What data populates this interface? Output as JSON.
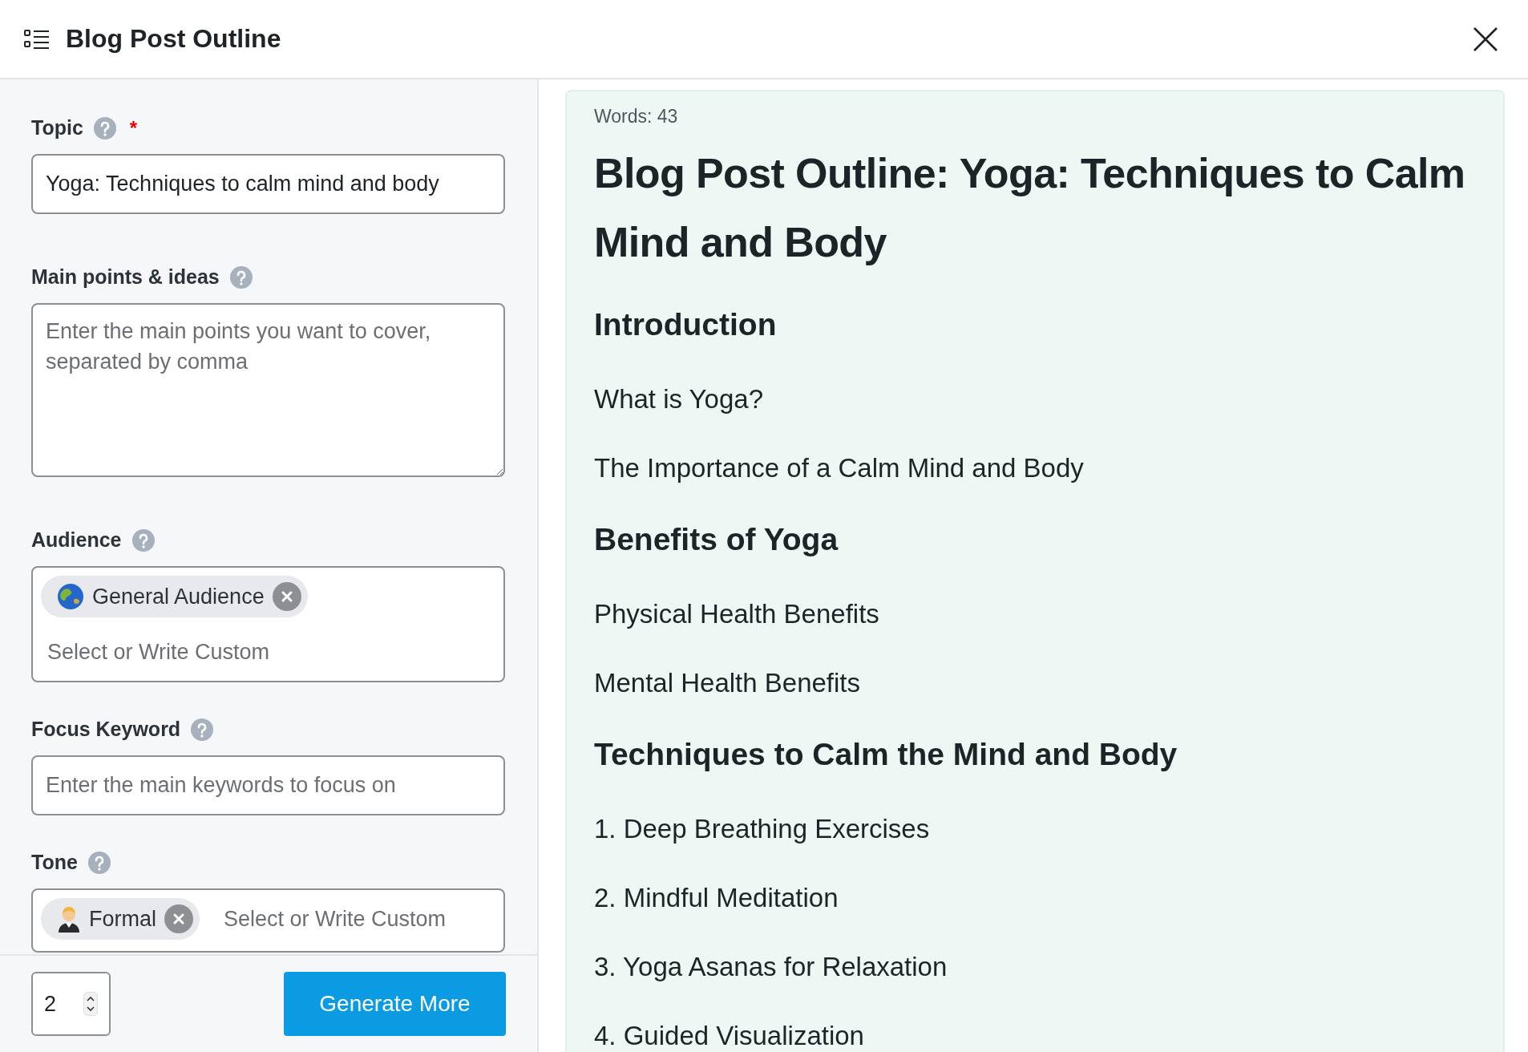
{
  "header": {
    "title": "Blog Post Outline"
  },
  "form": {
    "fields": [
      {
        "kind": "text",
        "label": "Topic",
        "required_mark": "*",
        "value": "Yoga: Techniques to calm mind and body"
      },
      {
        "kind": "textarea",
        "label": "Main points & ideas",
        "placeholder": "Enter the main points you want to cover, separated by comma"
      },
      {
        "kind": "tags",
        "label": "Audience",
        "tags": [
          {
            "label": "General Audience"
          }
        ],
        "placeholder": "Select or Write Custom",
        "inline": false
      },
      {
        "kind": "text",
        "label": "Focus Keyword",
        "placeholder": "Enter the main keywords to focus on"
      },
      {
        "kind": "tags",
        "label": "Tone",
        "tags": [
          {
            "label": "Formal"
          }
        ],
        "placeholder": "Select or Write Custom",
        "inline": true
      }
    ]
  },
  "footer": {
    "count": "2",
    "button": "Generate More"
  },
  "result": {
    "word_count": "Words: 43",
    "outline": [
      {
        "kind": "h1",
        "text": "Blog Post Outline: Yoga: Techniques to Calm Mind and Body"
      },
      {
        "kind": "h2",
        "text": "Introduction"
      },
      {
        "kind": "p",
        "text": "What is Yoga?"
      },
      {
        "kind": "p",
        "text": "The Importance of a Calm Mind and Body"
      },
      {
        "kind": "h2",
        "text": "Benefits of Yoga"
      },
      {
        "kind": "p",
        "text": "Physical Health Benefits"
      },
      {
        "kind": "p",
        "text": "Mental Health Benefits"
      },
      {
        "kind": "h2",
        "text": "Techniques to Calm the Mind and Body"
      },
      {
        "kind": "p",
        "text": "1. Deep Breathing Exercises"
      },
      {
        "kind": "p",
        "text": "2. Mindful Meditation"
      },
      {
        "kind": "p",
        "text": "3. Yoga Asanas for Relaxation"
      },
      {
        "kind": "p",
        "text": "4. Guided Visualization"
      }
    ]
  }
}
